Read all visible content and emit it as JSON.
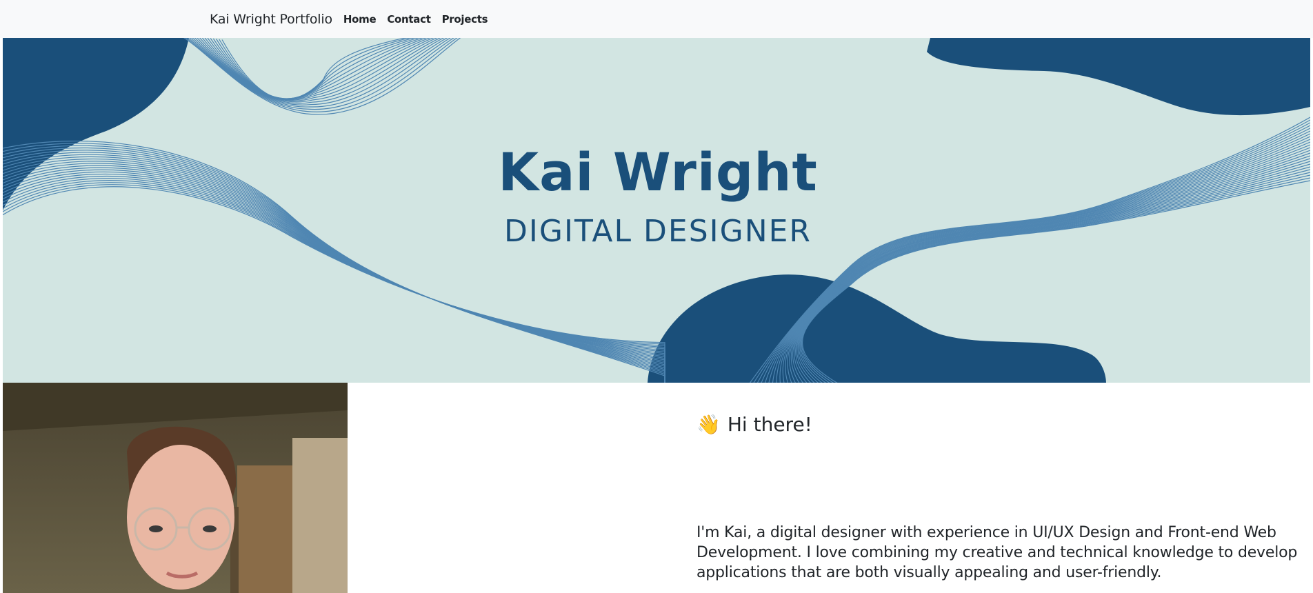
{
  "navbar": {
    "brand": "Kai Wright Portfolio",
    "links": [
      "Home",
      "Contact",
      "Projects"
    ]
  },
  "hero": {
    "name": "Kai Wright",
    "role": "DIGITAL DESIGNER"
  },
  "intro": {
    "greeting_icon": "waving-hand-icon",
    "greeting_emoji": "👋",
    "greeting": "Hi there!",
    "bio": "I'm Kai, a digital designer with experience in UI/UX Design and Front-end Web Development. I love combining my creative and technical knowledge to develop applications that are both visually appealing and user-friendly."
  },
  "colors": {
    "navbar_bg": "#f8f9fa",
    "hero_bg": "#d2e5e2",
    "brand_blue": "#1a4f7a",
    "line_blue": "#4f86b2",
    "text": "#212529"
  }
}
